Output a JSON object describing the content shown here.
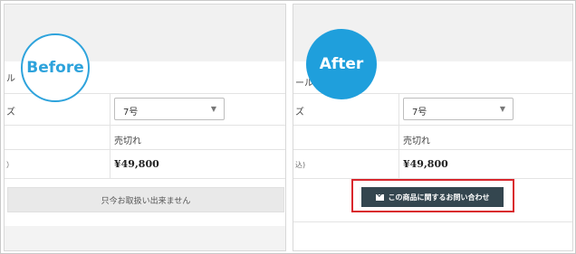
{
  "before": {
    "badge_label": "Before",
    "row1_label": "ル",
    "row2_label": "ズ",
    "row4_label": "）",
    "size_select_value": "7号",
    "stock_status": "売切れ",
    "price": "¥49,800",
    "unavailable_label": "只今お取扱い出来ません"
  },
  "after": {
    "badge_label": "After",
    "row1_label": "ール",
    "row2_label": "ズ",
    "row4_label": "込)",
    "size_select_value": "7号",
    "stock_status": "売切れ",
    "price": "¥49,800",
    "contact_button_label": "この商品に関するお問い合わせ"
  },
  "icons": {
    "select_arrow": "chevron-down-icon",
    "contact_icon": "mail-icon"
  },
  "colors": {
    "badge_blue": "#1f9fdc",
    "highlight_red": "#d9272d",
    "contact_button": "#34464f"
  }
}
